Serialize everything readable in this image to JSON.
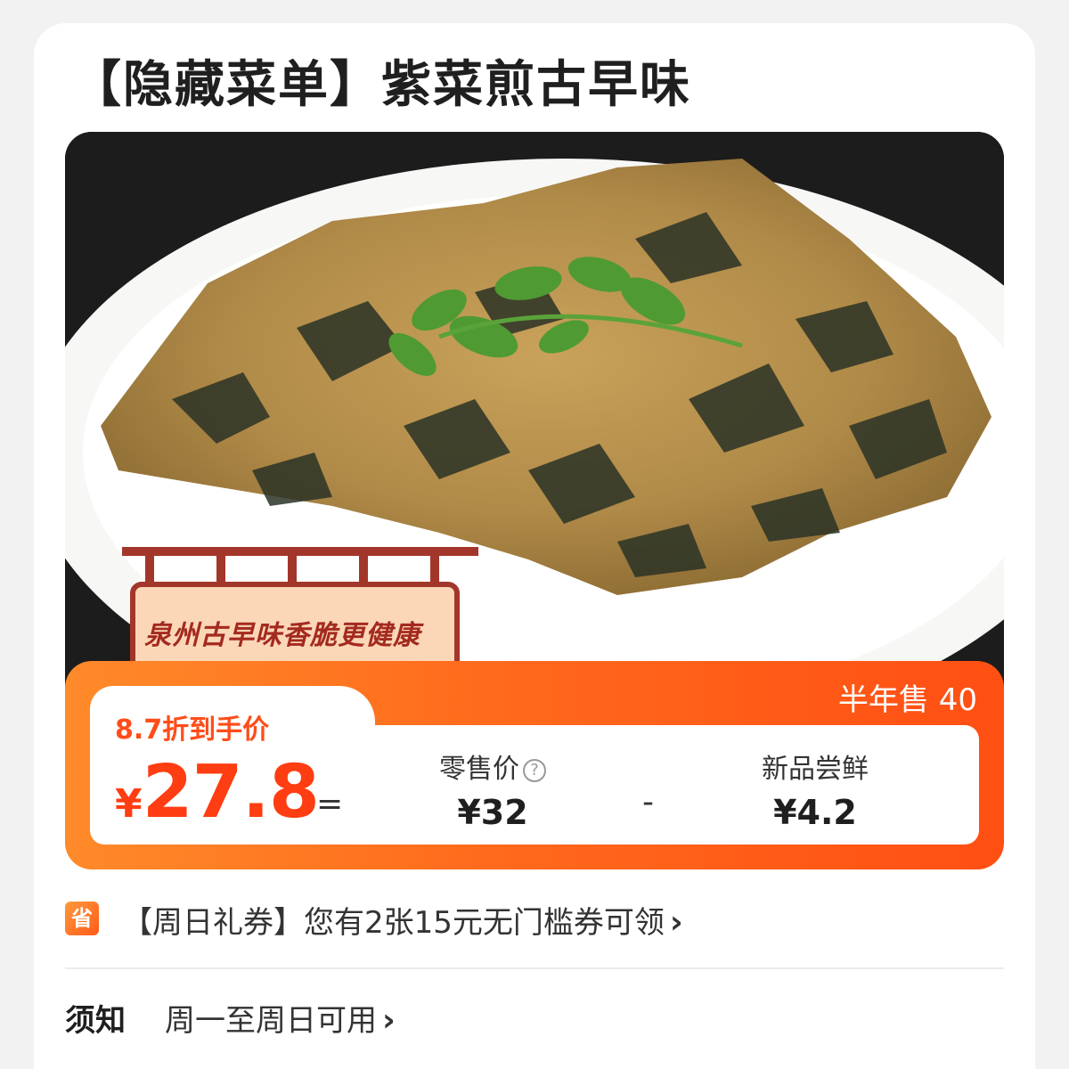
{
  "product": {
    "title": "【隐藏菜单】紫菜煎古早味",
    "image_caption": "泉州古早味香脆更健康"
  },
  "price": {
    "sold_label": "半年售 40",
    "discount_label": "8.7折到手价",
    "final_currency": "¥",
    "final_value": "27.8",
    "equals": "=",
    "minus": "-",
    "retail_label": "零售价",
    "retail_value": "¥32",
    "new_label": "新品尝鲜",
    "new_value": "¥4.2",
    "help_glyph": "?"
  },
  "coupon": {
    "icon_text": "省",
    "text": "【周日礼券】您有2张15元无门槛券可领",
    "chevron": "›"
  },
  "notice": {
    "label": "须知",
    "text": "周一至周日可用",
    "chevron": "›"
  },
  "colors": {
    "accent": "#ff4d1a",
    "banner_start": "#ff8a2a",
    "banner_end": "#ff4f14"
  }
}
